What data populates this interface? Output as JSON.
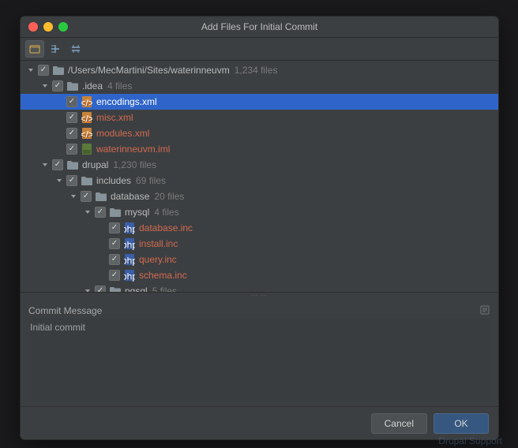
{
  "title": "Add Files For Initial Commit",
  "toolbar": {
    "group_by_dir": "group-by-directory-icon",
    "expand_all": "expand-all-icon",
    "collapse_all": "collapse-all-icon"
  },
  "tree": [
    {
      "indent": 0,
      "arrow": "down",
      "checked": true,
      "icon": "folder",
      "name": "/Users/MecMartini/Sites/waterinneuvm",
      "count": "1,234 files",
      "mod": false,
      "sel": false
    },
    {
      "indent": 1,
      "arrow": "down",
      "checked": true,
      "icon": "folder",
      "name": ".idea",
      "count": "4 files",
      "mod": false,
      "sel": false
    },
    {
      "indent": 2,
      "arrow": "",
      "checked": true,
      "icon": "file-xml",
      "name": "encodings.xml",
      "count": "",
      "mod": true,
      "sel": true
    },
    {
      "indent": 2,
      "arrow": "",
      "checked": true,
      "icon": "file-xml",
      "name": "misc.xml",
      "count": "",
      "mod": true,
      "sel": false
    },
    {
      "indent": 2,
      "arrow": "",
      "checked": true,
      "icon": "file-xml",
      "name": "modules.xml",
      "count": "",
      "mod": true,
      "sel": false
    },
    {
      "indent": 2,
      "arrow": "",
      "checked": true,
      "icon": "file-iml",
      "name": "waterinneuvm.iml",
      "count": "",
      "mod": true,
      "sel": false
    },
    {
      "indent": 1,
      "arrow": "down",
      "checked": true,
      "icon": "folder",
      "name": "drupal",
      "count": "1,230 files",
      "mod": false,
      "sel": false
    },
    {
      "indent": 2,
      "arrow": "down",
      "checked": true,
      "icon": "folder",
      "name": "includes",
      "count": "69 files",
      "mod": false,
      "sel": false
    },
    {
      "indent": 3,
      "arrow": "down",
      "checked": true,
      "icon": "folder",
      "name": "database",
      "count": "20 files",
      "mod": false,
      "sel": false
    },
    {
      "indent": 4,
      "arrow": "down",
      "checked": true,
      "icon": "folder",
      "name": "mysql",
      "count": "4 files",
      "mod": false,
      "sel": false
    },
    {
      "indent": 5,
      "arrow": "",
      "checked": true,
      "icon": "file-php",
      "name": "database.inc",
      "count": "",
      "mod": true,
      "sel": false
    },
    {
      "indent": 5,
      "arrow": "",
      "checked": true,
      "icon": "file-php",
      "name": "install.inc",
      "count": "",
      "mod": true,
      "sel": false
    },
    {
      "indent": 5,
      "arrow": "",
      "checked": true,
      "icon": "file-php",
      "name": "query.inc",
      "count": "",
      "mod": true,
      "sel": false
    },
    {
      "indent": 5,
      "arrow": "",
      "checked": true,
      "icon": "file-php",
      "name": "schema.inc",
      "count": "",
      "mod": true,
      "sel": false
    },
    {
      "indent": 4,
      "arrow": "down",
      "checked": true,
      "icon": "folder",
      "name": "pgsql",
      "count": "5 files",
      "mod": false,
      "sel": false
    }
  ],
  "commit": {
    "label": "Commit Message",
    "value": "Initial commit"
  },
  "buttons": {
    "cancel": "Cancel",
    "ok": "OK"
  },
  "footer_hint": "Drupal Support"
}
